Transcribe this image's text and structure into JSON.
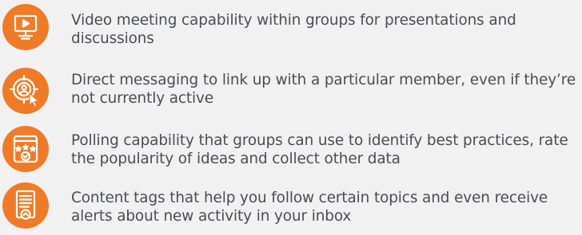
{
  "accent_color": "#f07b27",
  "text_color": "#4b4d50",
  "features": [
    {
      "icon": "video-presentation-icon",
      "text": "Video meeting capability within groups for presentations and discussions"
    },
    {
      "icon": "direct-message-target-icon",
      "text": "Direct messaging to link up with a particular member, even if they’re not currently active"
    },
    {
      "icon": "poll-rating-icon",
      "text": "Polling capability that groups can use to identify best practices, rate the popularity of ideas and collect other data"
    },
    {
      "icon": "content-tag-alert-icon",
      "text": "Content tags that help you follow certain topics and even receive alerts about new activity in your inbox"
    }
  ]
}
